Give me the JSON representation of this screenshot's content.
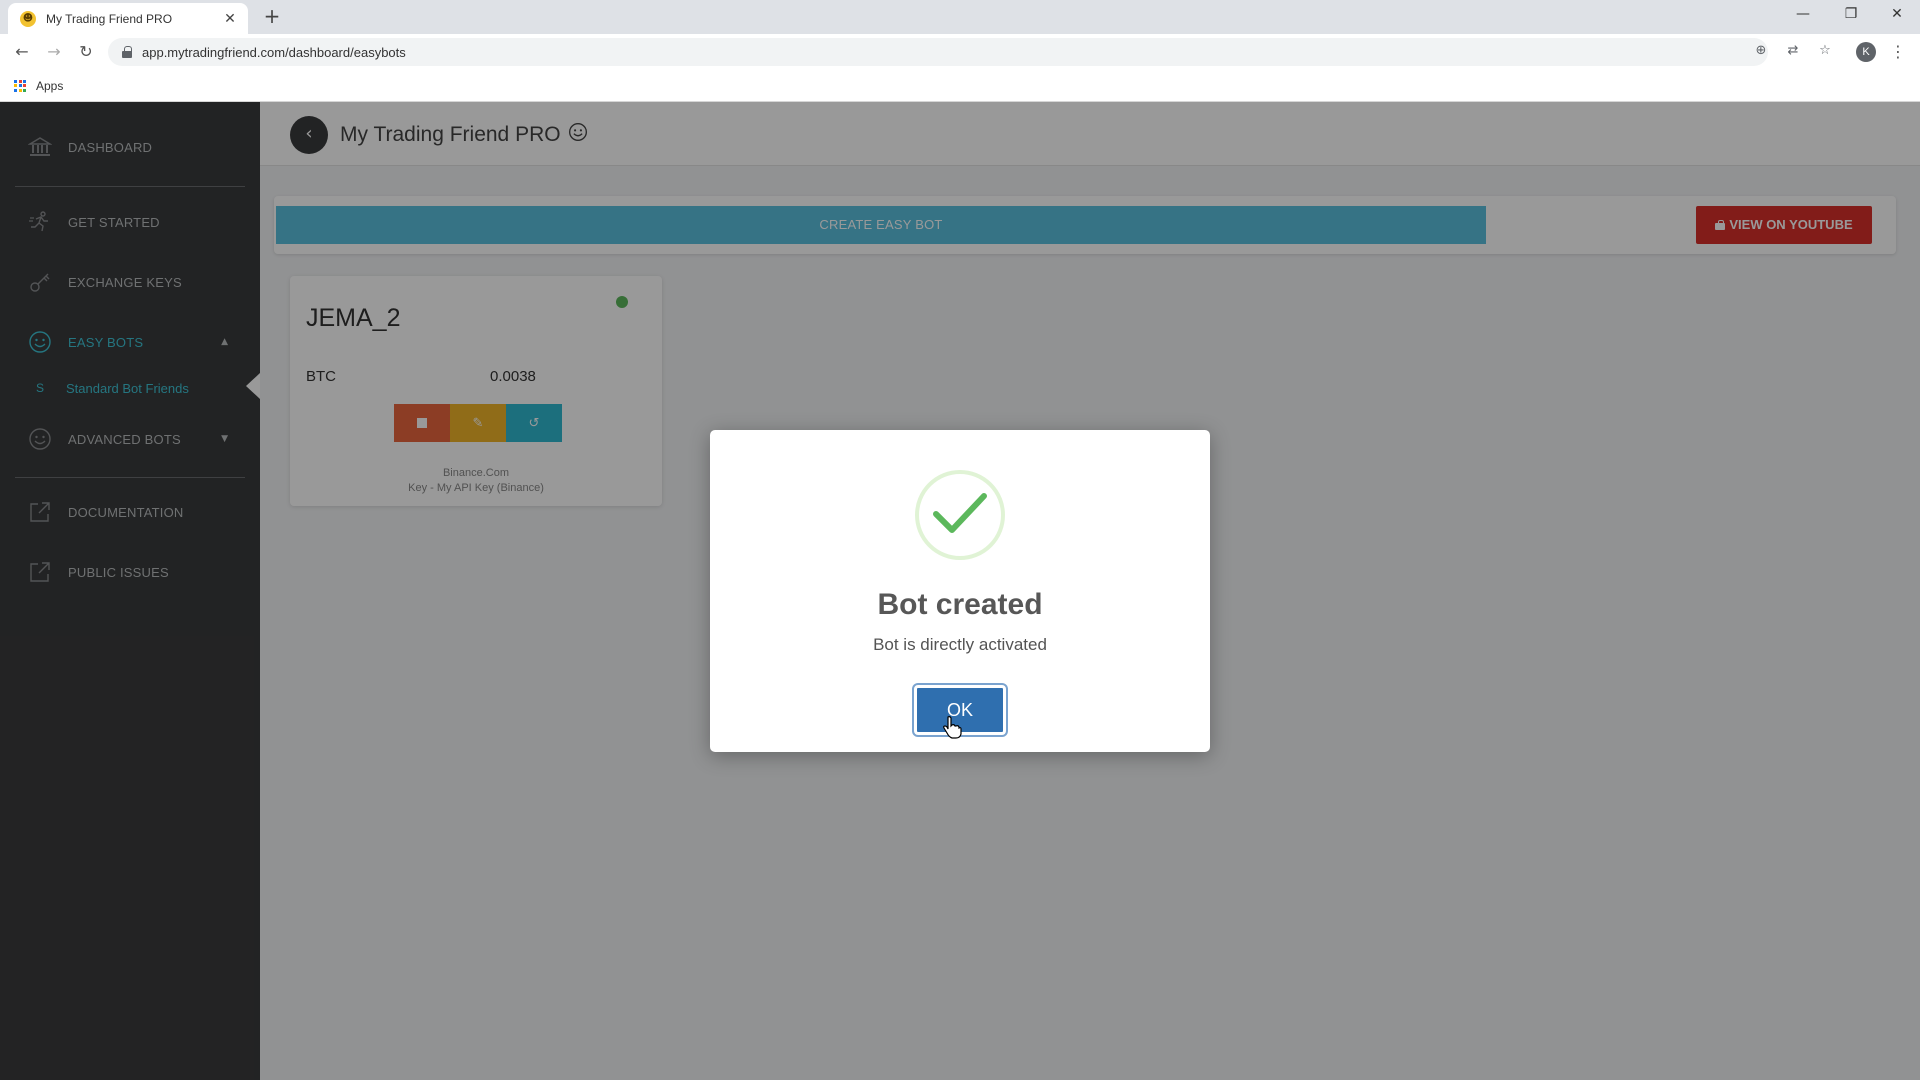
{
  "browser": {
    "tab_title": "My Trading Friend PRO",
    "tab_favicon": "smiley-icon",
    "url": "app.mytradingfriend.com/dashboard/easybots",
    "bookmarks": {
      "apps_label": "Apps"
    },
    "profile_initial": "K"
  },
  "sidebar": {
    "items": [
      {
        "label": "DASHBOARD",
        "icon": "bank-icon"
      },
      {
        "label": "GET STARTED",
        "icon": "runner-icon"
      },
      {
        "label": "EXCHANGE KEYS",
        "icon": "key-icon"
      },
      {
        "label": "EASY BOTS",
        "icon": "smiley-icon",
        "active": true,
        "expanded": true
      },
      {
        "label": "ADVANCED BOTS",
        "icon": "smiley-icon",
        "expanded": false
      },
      {
        "label": "DOCUMENTATION",
        "icon": "external-link-icon"
      },
      {
        "label": "PUBLIC ISSUES",
        "icon": "external-link-icon"
      }
    ],
    "sub_item": {
      "prefix": "S",
      "label": "Standard Bot Friends"
    },
    "accent_color": "#3ec4d6"
  },
  "header": {
    "title": "My Trading Friend PRO"
  },
  "actions": {
    "create_label": "CREATE EASY BOT",
    "youtube_label": "VIEW ON YOUTUBE"
  },
  "bot_card": {
    "name": "JEMA_2",
    "status": "active",
    "status_color": "#5cb85c",
    "coin": "BTC",
    "amount": "0.0038",
    "exchange": "Binance.Com",
    "key": "Key - My API Key (Binance)"
  },
  "modal": {
    "title": "Bot created",
    "text": "Bot is directly activated",
    "ok_label": "OK"
  }
}
